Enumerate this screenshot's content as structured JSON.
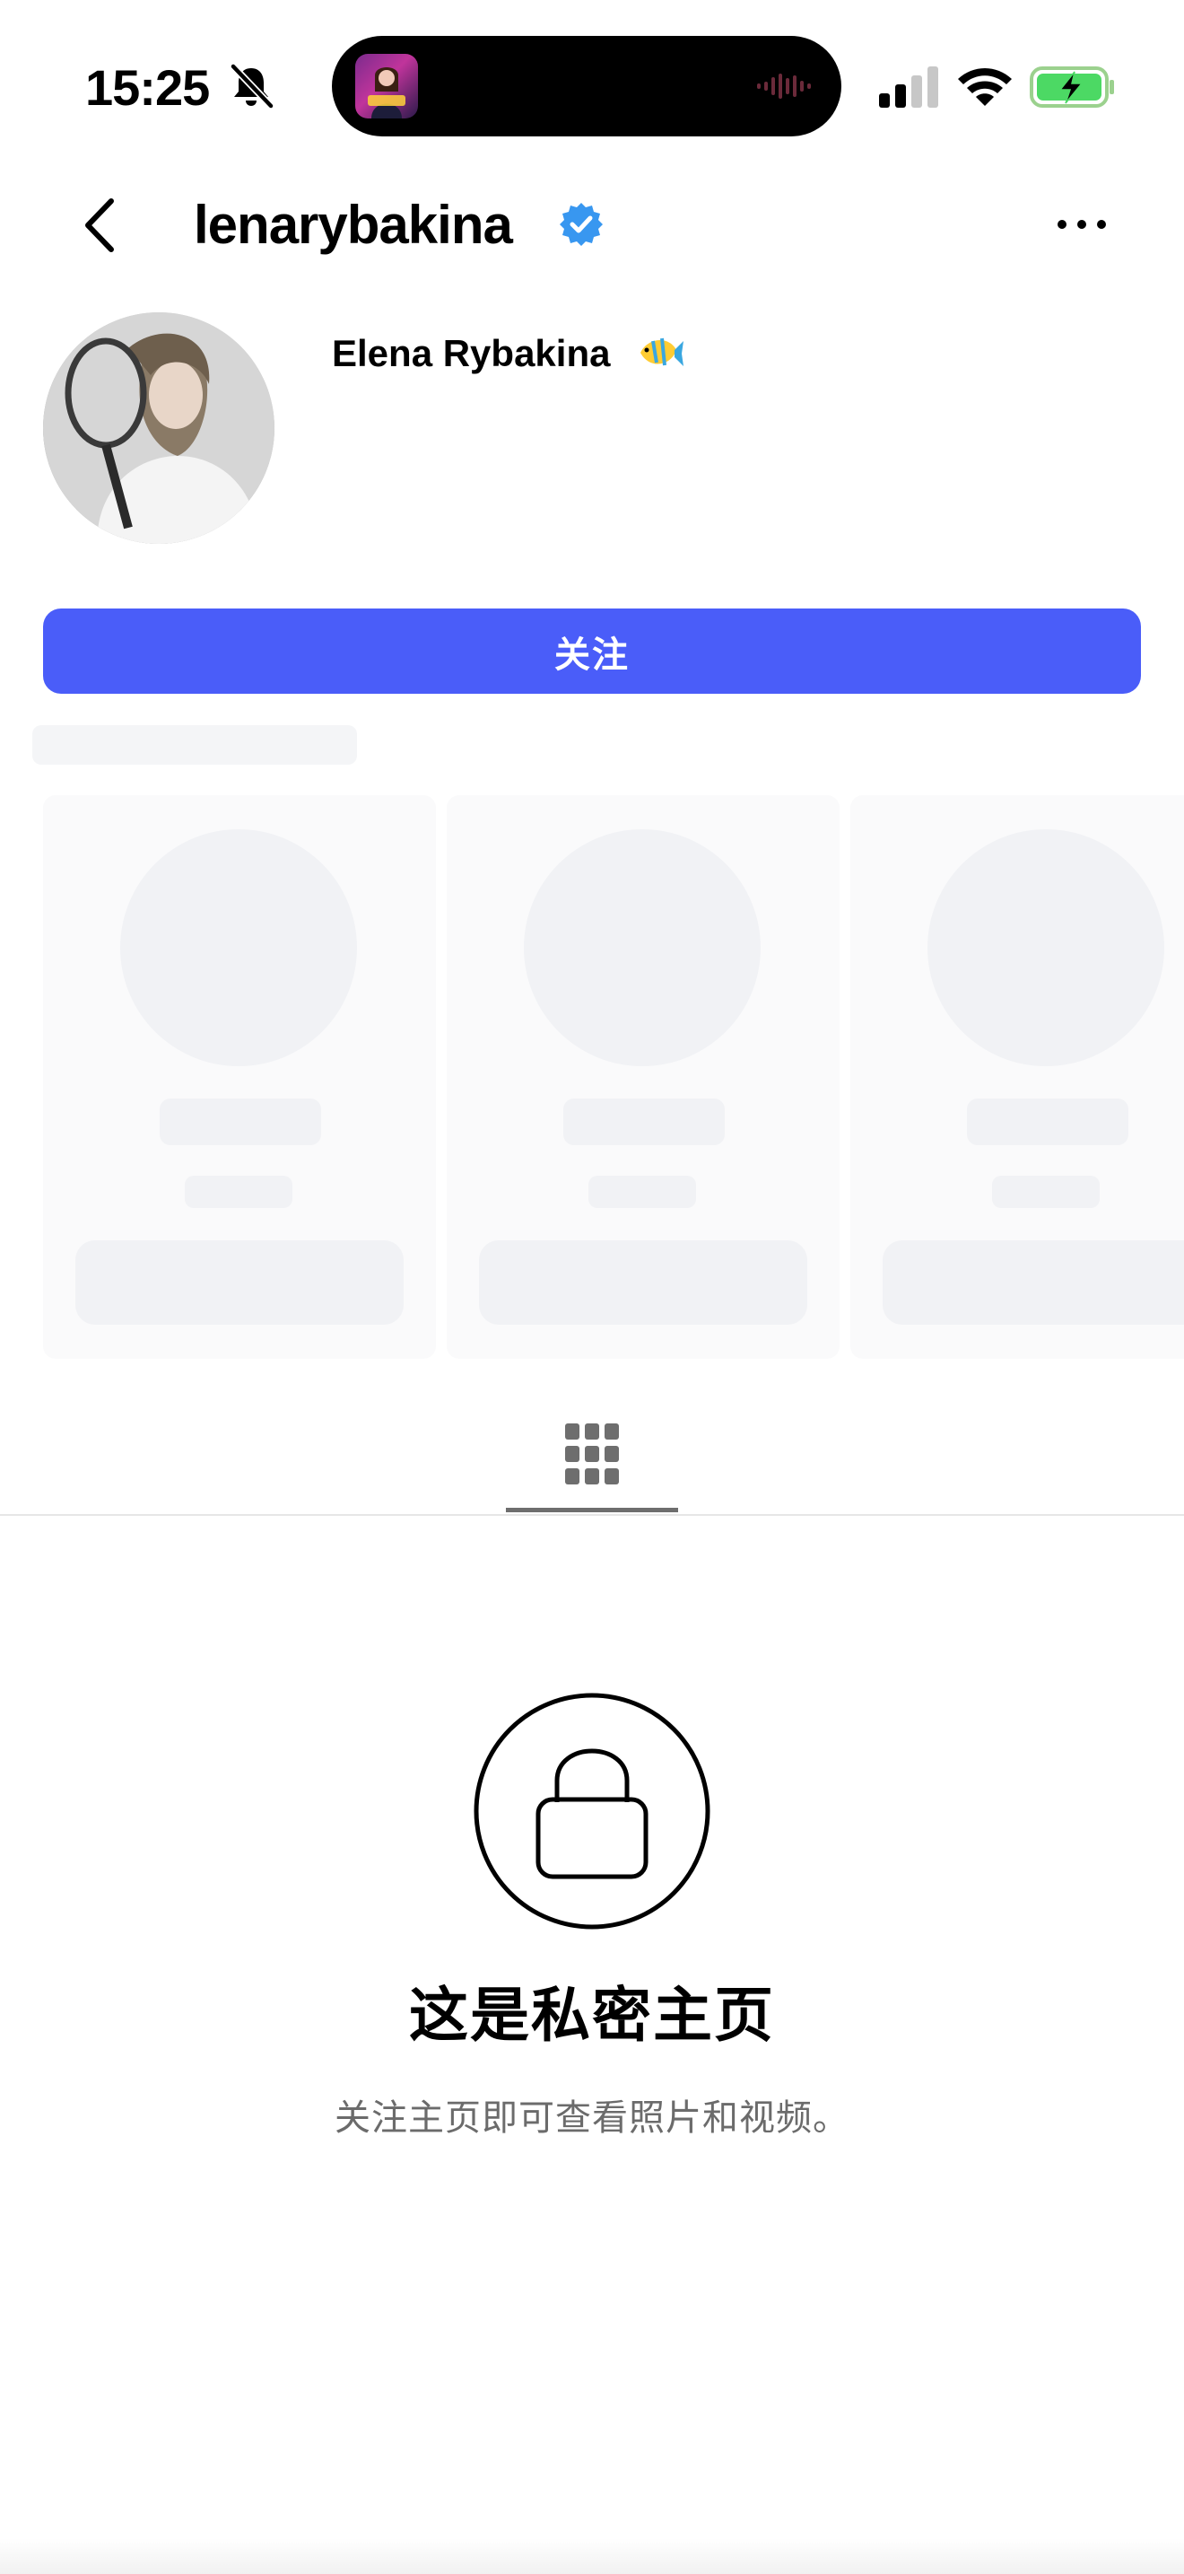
{
  "status_bar": {
    "time": "15:25",
    "icons": [
      "bell-slash-icon",
      "signal-icon",
      "wifi-icon",
      "battery-charging-icon"
    ]
  },
  "header": {
    "username": "lenarybakina",
    "verified": true,
    "icons": [
      "back-icon",
      "verified-icon",
      "more-icon"
    ]
  },
  "profile": {
    "display_name": "Elena Rybakina",
    "emoji_icon": "tropical-fish-icon"
  },
  "actions": {
    "follow_label": "关注"
  },
  "tabs": {
    "active_icon": "grid-icon"
  },
  "private": {
    "icon": "lock-icon",
    "title": "这是私密主页",
    "subtitle": "关注主页即可查看照片和视频。"
  },
  "colors": {
    "accent": "#4a5df9",
    "verified": "#3897f0",
    "text_primary": "#000000",
    "text_secondary": "#6b6b6b",
    "skeleton": "#f1f2f5",
    "battery_green": "#4cd964"
  }
}
